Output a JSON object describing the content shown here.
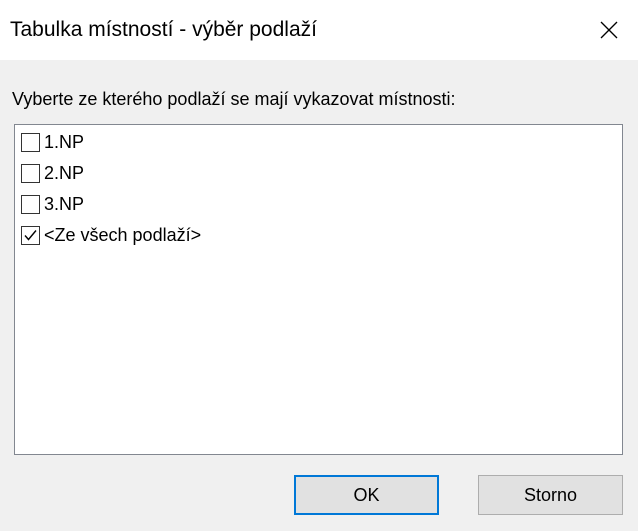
{
  "window": {
    "title": "Tabulka místností - výběr podlaží"
  },
  "prompt": "Vyberte ze kterého podlaží se mají vykazovat místnosti:",
  "floors": [
    {
      "label": "1.NP",
      "checked": false
    },
    {
      "label": "2.NP",
      "checked": false
    },
    {
      "label": "3.NP",
      "checked": false
    },
    {
      "label": "<Ze všech podlaží>",
      "checked": true
    }
  ],
  "buttons": {
    "ok_label": "OK",
    "cancel_label": "Storno"
  },
  "colors": {
    "focus_border": "#0078d7",
    "dialog_background": "#f0f0f0"
  }
}
